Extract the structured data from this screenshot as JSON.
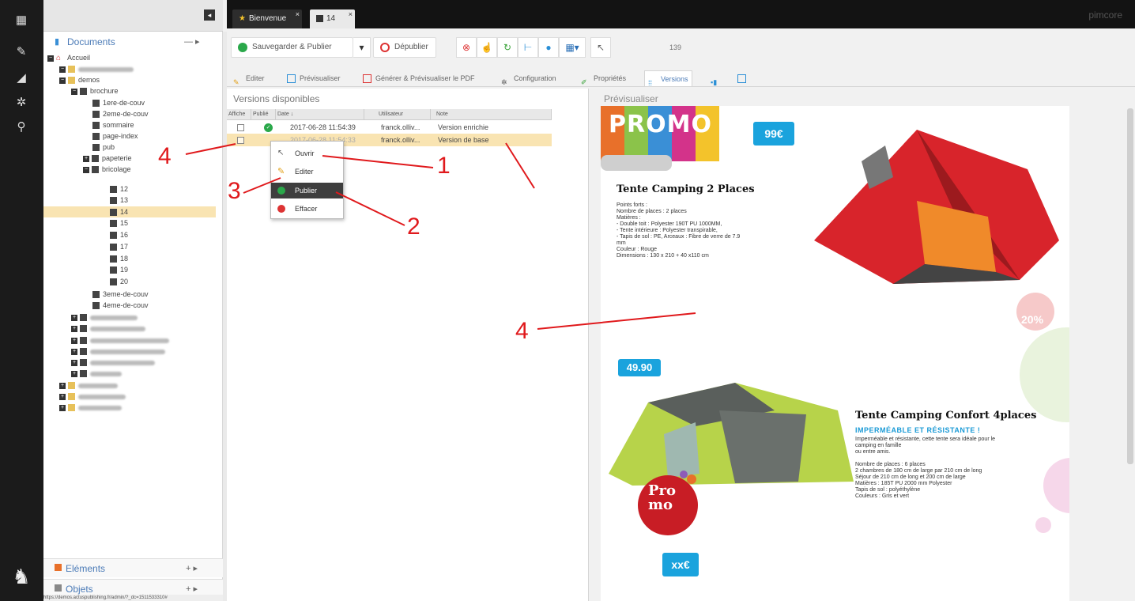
{
  "tree_panel": {
    "section_title": "Documents",
    "section_actions": "— ▸",
    "nodes": {
      "accueil": "Accueil",
      "demos": "demos",
      "brochure": "brochure",
      "c1": "1ere-de-couv",
      "c2": "2eme-de-couv",
      "sommaire": "sommaire",
      "page_index": "page-index",
      "pub": "pub",
      "papeterie": "papeterie",
      "bricolage": "bricolage",
      "n12": "12",
      "n13": "13",
      "n14": "14",
      "n15": "15",
      "n16": "16",
      "n17": "17",
      "n18": "18",
      "n19": "19",
      "n20": "20",
      "c3": "3eme-de-couv",
      "c4": "4eme-de-couv"
    },
    "accordion": [
      {
        "label": "Eléments",
        "actions": "+ ▸"
      },
      {
        "label": "Objets",
        "actions": "+ ▸"
      }
    ],
    "status_url": "https://demos.actuspublishing.fr/admin/?_dc=1511533310#"
  },
  "tabs": [
    {
      "label": "Bienvenue",
      "close": "×"
    },
    {
      "label": "14",
      "close": "×"
    }
  ],
  "brand": "pimcore",
  "toolbar": {
    "save_publish": "Sauvegarder & Publier",
    "unpublish": "Dépublier",
    "id_number": "139"
  },
  "subtabs": {
    "edit": "Editer",
    "preview": "Prévisualiser",
    "pdf": "Générer & Prévisualiser le PDF",
    "config": "Configuration",
    "properties": "Propriétés",
    "versions": "Versions"
  },
  "versions": {
    "title": "Versions disponibles",
    "columns": [
      "Affiche",
      "Publié",
      "Date ↓",
      "Utilisateur",
      "Note"
    ],
    "rows": [
      {
        "date": "2017-06-28 11:54:39",
        "user": "franck.olliv...",
        "note": "Version enrichie",
        "published": true,
        "selected": false
      },
      {
        "date": "2017-06-28 11:54:33",
        "user": "franck.olliv...",
        "note": "Version de base",
        "published": false,
        "selected": true
      }
    ]
  },
  "context_menu": {
    "items": [
      "Ouvrir",
      "Editer",
      "Publier",
      "Effacer"
    ],
    "highlighted": "Publier"
  },
  "preview": {
    "title": "Prévisualiser",
    "promo": "PROMO",
    "price1": "99€",
    "product1_title": "Tente Camping 2 Places",
    "product1_desc": "Points forts :\nNombre de places : 2 places\nMatières :\n- Double toit : Polyester 190T PU 1000MM,\n- Tente intérieure : Polyester transpirable,\n- Tapis de sol : PE, Arceaux : Fibre de verre de 7.9\nmm\nCouleur : Rouge\nDimensions : 130 x 210 + 40 x110 cm",
    "discount": "20%",
    "price2": "49.90",
    "product2_title": "Tente Camping Confort 4places",
    "product2_subtitle": "IMPERMÉABLE ET RÉSISTANTE !",
    "product2_desc": "Imperméable et résistante, cette tente sera idéale pour le\ncamping en famille\nou entre amis.\n\nNombre de places : 6 places\n2 chambres de 180 cm de large par 210 cm de long\nSéjour de 210 cm de long et 200 cm de large\nMatières : 185T PU 2000 mm Polyester\nTapis de sol : polyéthylène\nCouleurs : Gris et vert",
    "promo_stamp": "Pro\nmo",
    "price3": "xx€"
  },
  "annotations": [
    "4",
    "1",
    "3",
    "2",
    "4"
  ],
  "colors": {
    "accent": "#4b7bb7",
    "selection": "#f9e4b2",
    "annotation": "#e0191c",
    "published": "#2aa84a"
  }
}
